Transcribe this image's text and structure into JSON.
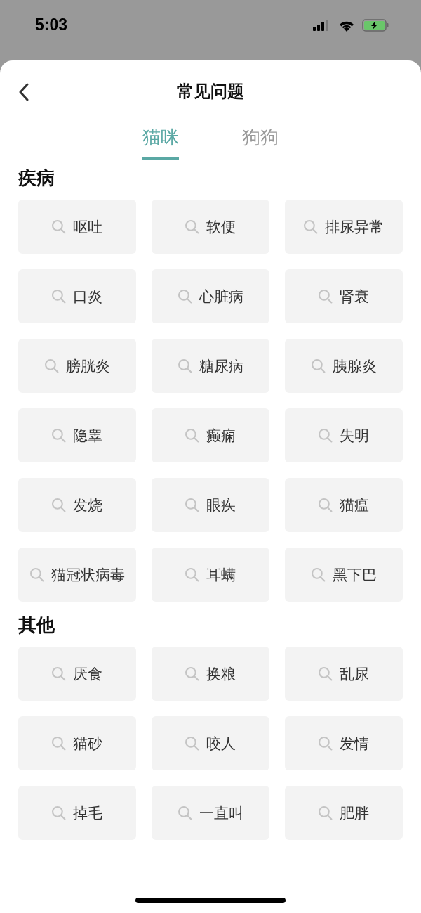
{
  "status_bar": {
    "time": "5:03"
  },
  "header": {
    "title": "常见问题"
  },
  "tabs": [
    {
      "label": "猫咪",
      "selected": true
    },
    {
      "label": "狗狗",
      "selected": false
    }
  ],
  "sections": [
    {
      "title": "疾病",
      "items": [
        "呕吐",
        "软便",
        "排尿异常",
        "口炎",
        "心脏病",
        "肾衰",
        "膀胱炎",
        "糖尿病",
        "胰腺炎",
        "隐睾",
        "癫痫",
        "失明",
        "发烧",
        "眼疾",
        "猫瘟",
        "猫冠状病毒",
        "耳螨",
        "黑下巴"
      ]
    },
    {
      "title": "其他",
      "items": [
        "厌食",
        "换粮",
        "乱尿",
        "猫砂",
        "咬人",
        "发情",
        "掉毛",
        "一直叫",
        "肥胖"
      ]
    }
  ]
}
